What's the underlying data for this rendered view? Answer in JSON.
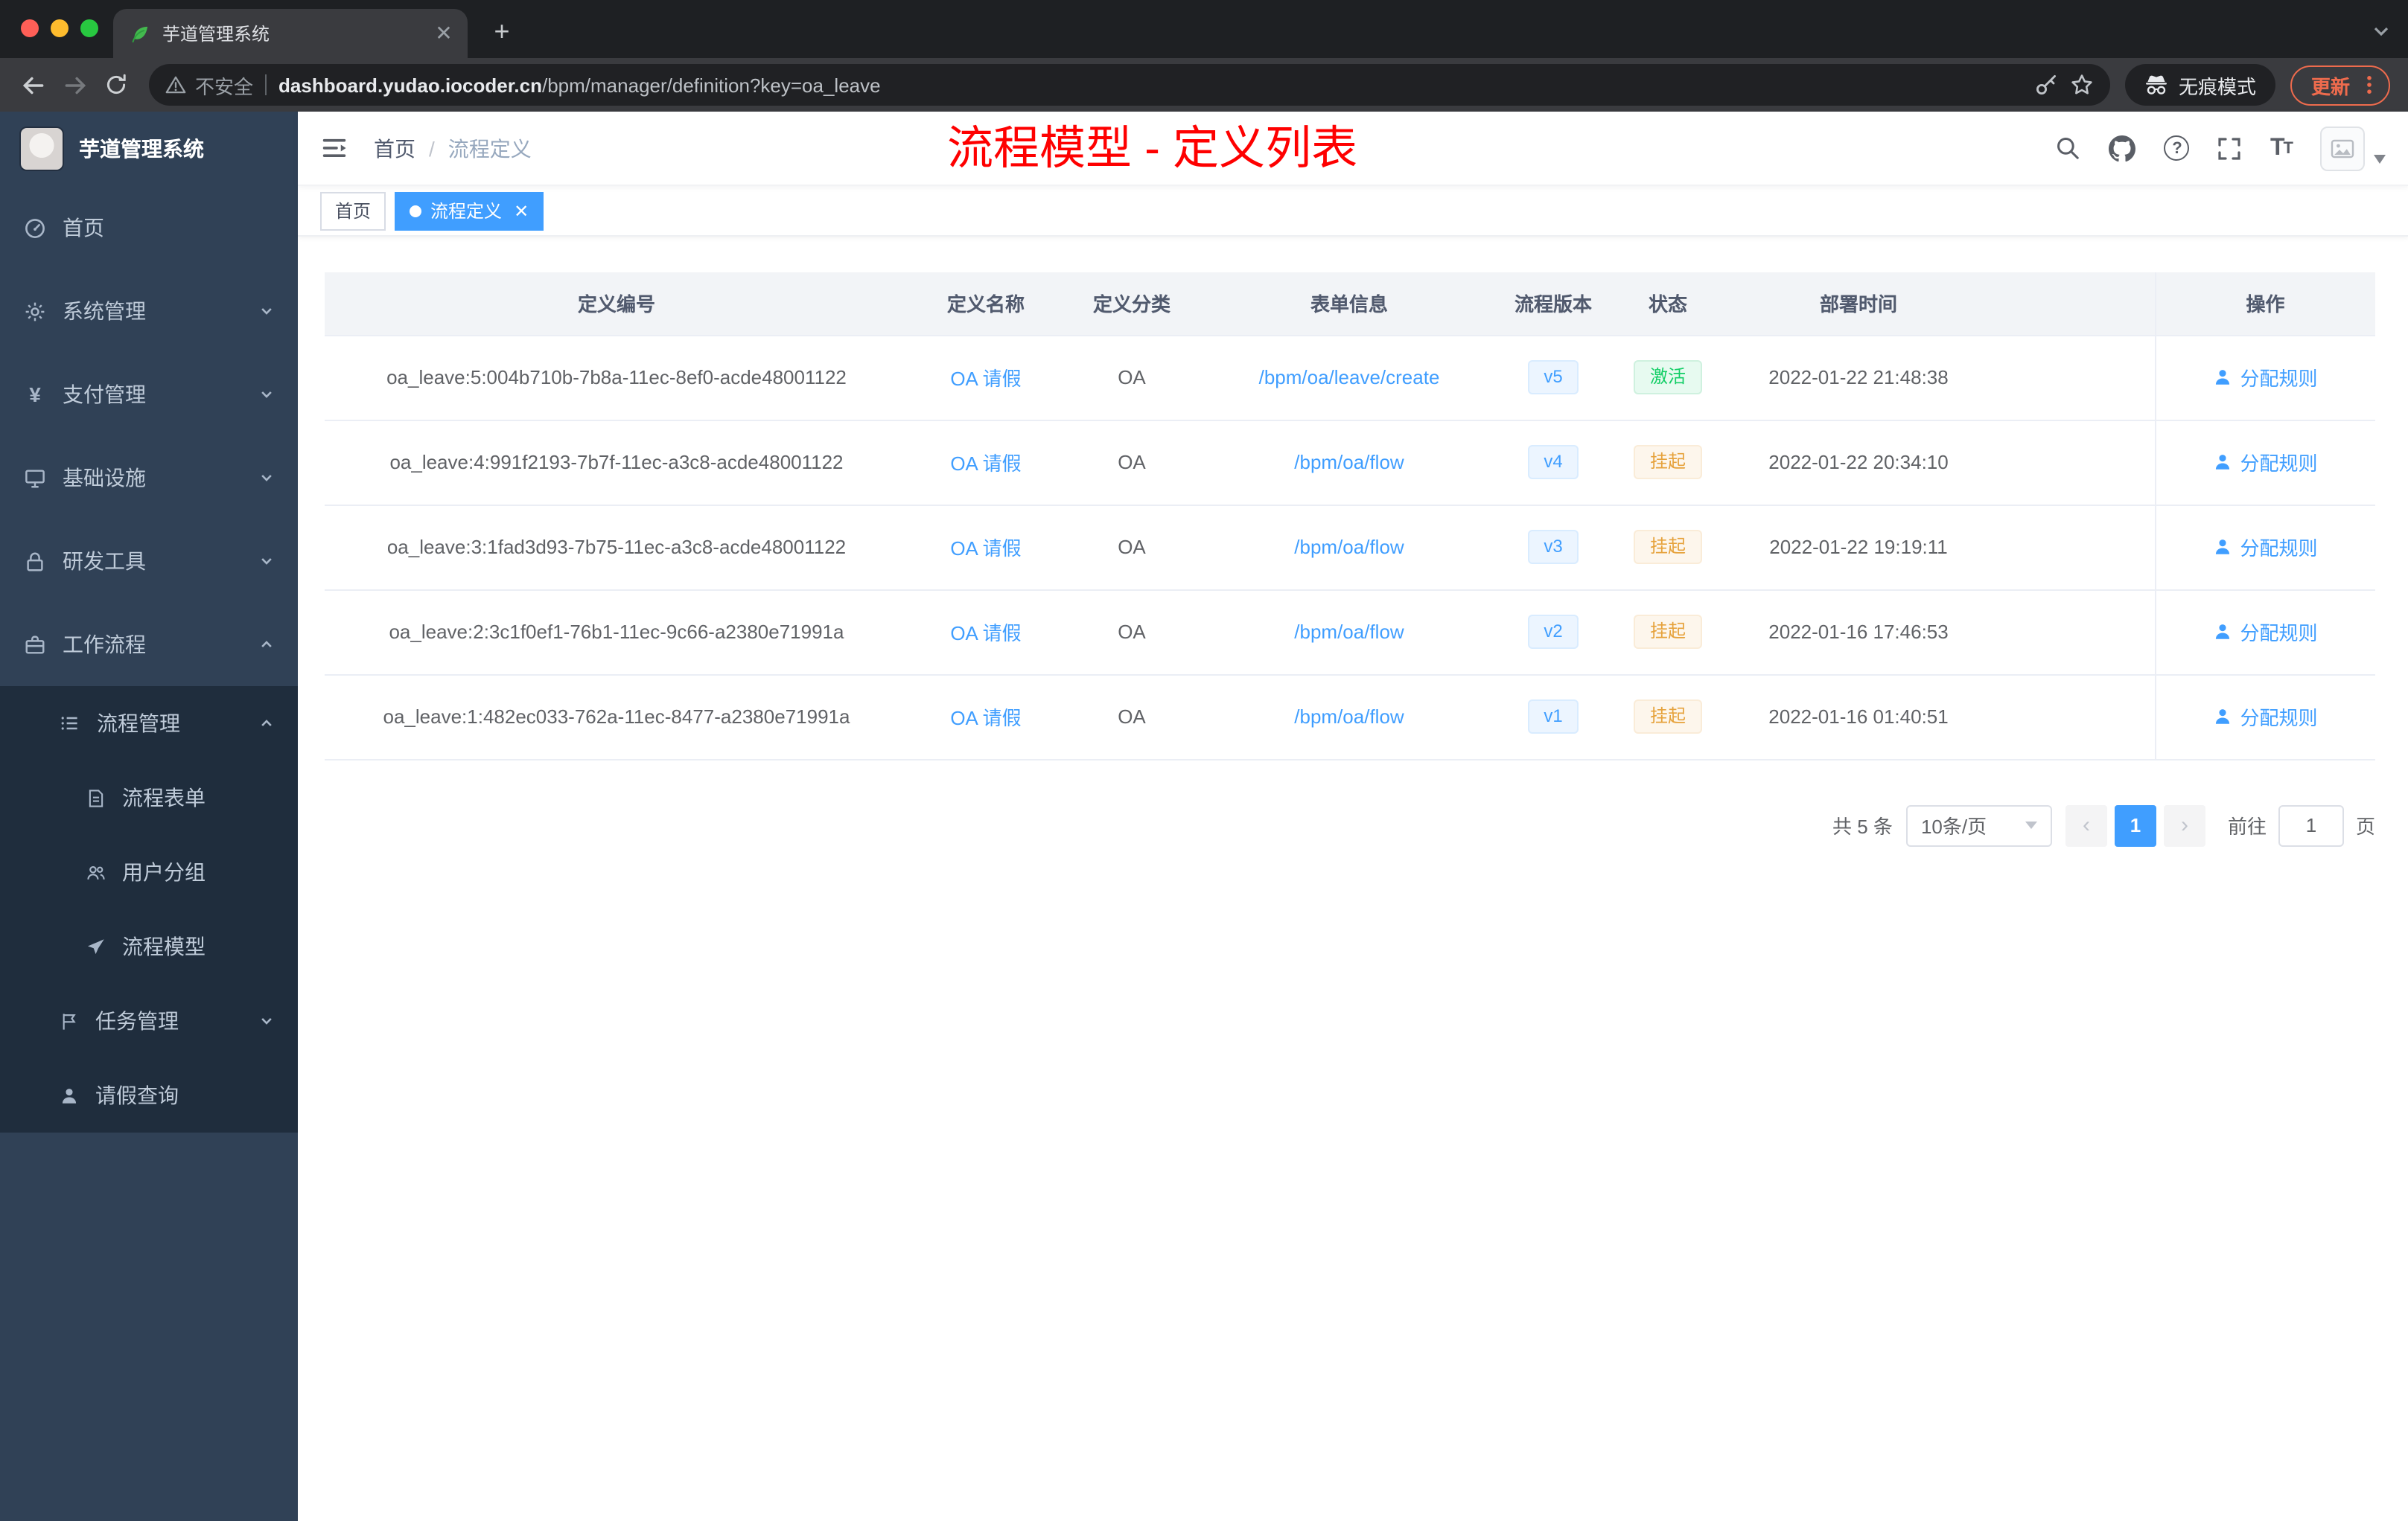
{
  "browser": {
    "tab_title": "芋道管理系统",
    "security_label": "不安全",
    "url_domain": "dashboard.yudao.iocoder.cn",
    "url_path": "/bpm/manager/definition?key=oa_leave",
    "profile_label": "无痕模式",
    "update_label": "更新"
  },
  "sidebar": {
    "app_title": "芋道管理系统",
    "items": [
      {
        "label": "首页",
        "icon": "dashboard-icon",
        "level": 1
      },
      {
        "label": "系统管理",
        "icon": "gear-icon",
        "level": 1,
        "expandable": true
      },
      {
        "label": "支付管理",
        "icon": "yen-icon",
        "level": 1,
        "expandable": true
      },
      {
        "label": "基础设施",
        "icon": "monitor-icon",
        "level": 1,
        "expandable": true
      },
      {
        "label": "研发工具",
        "icon": "lock-icon",
        "level": 1,
        "expandable": true
      },
      {
        "label": "工作流程",
        "icon": "briefcase-icon",
        "level": 1,
        "expandable": true,
        "expanded": true
      },
      {
        "label": "流程管理",
        "icon": "list-icon",
        "level": 2,
        "expandable": true,
        "expanded": true
      },
      {
        "label": "流程表单",
        "icon": "document-icon",
        "level": 3
      },
      {
        "label": "用户分组",
        "icon": "users-icon",
        "level": 3
      },
      {
        "label": "流程模型",
        "icon": "send-icon",
        "level": 3
      },
      {
        "label": "任务管理",
        "icon": "flag-icon",
        "level": 2,
        "expandable": true
      },
      {
        "label": "请假查询",
        "icon": "user-icon",
        "level": 2
      }
    ]
  },
  "header": {
    "breadcrumb": {
      "root": "首页",
      "separator": "/",
      "current": "流程定义"
    },
    "annotation": "流程模型 - 定义列表"
  },
  "tags_view": {
    "tags": [
      {
        "label": "首页",
        "active": false
      },
      {
        "label": "流程定义",
        "active": true
      }
    ]
  },
  "table": {
    "columns": [
      "定义编号",
      "定义名称",
      "定义分类",
      "表单信息",
      "流程版本",
      "状态",
      "部署时间",
      "操作"
    ],
    "rows": [
      {
        "id": "oa_leave:5:004b710b-7b8a-11ec-8ef0-acde48001122",
        "name": "OA 请假",
        "category": "OA",
        "form": "/bpm/oa/leave/create",
        "version": "v5",
        "status": "激活",
        "status_type": "success",
        "deploy_time": "2022-01-22 21:48:38",
        "action": "分配规则"
      },
      {
        "id": "oa_leave:4:991f2193-7b7f-11ec-a3c8-acde48001122",
        "name": "OA 请假",
        "category": "OA",
        "form": "/bpm/oa/flow",
        "version": "v4",
        "status": "挂起",
        "status_type": "warning",
        "deploy_time": "2022-01-22 20:34:10",
        "action": "分配规则"
      },
      {
        "id": "oa_leave:3:1fad3d93-7b75-11ec-a3c8-acde48001122",
        "name": "OA 请假",
        "category": "OA",
        "form": "/bpm/oa/flow",
        "version": "v3",
        "status": "挂起",
        "status_type": "warning",
        "deploy_time": "2022-01-22 19:19:11",
        "action": "分配规则"
      },
      {
        "id": "oa_leave:2:3c1f0ef1-76b1-11ec-9c66-a2380e71991a",
        "name": "OA 请假",
        "category": "OA",
        "form": "/bpm/oa/flow",
        "version": "v2",
        "status": "挂起",
        "status_type": "warning",
        "deploy_time": "2022-01-16 17:46:53",
        "action": "分配规则"
      },
      {
        "id": "oa_leave:1:482ec033-762a-11ec-8477-a2380e71991a",
        "name": "OA 请假",
        "category": "OA",
        "form": "/bpm/oa/flow",
        "version": "v1",
        "status": "挂起",
        "status_type": "warning",
        "deploy_time": "2022-01-16 01:40:51",
        "action": "分配规则"
      }
    ]
  },
  "pagination": {
    "total_label": "共 5 条",
    "page_size_label": "10条/页",
    "current_page": "1",
    "goto_label": "前往",
    "goto_value": "1",
    "goto_unit": "页"
  },
  "colors": {
    "accent": "#409eff",
    "success": "#13ce66",
    "warning": "#e6a23c",
    "annotation_red": "#fe0000",
    "sidebar_bg": "#304156",
    "submenu_bg": "#1f2d3d"
  }
}
